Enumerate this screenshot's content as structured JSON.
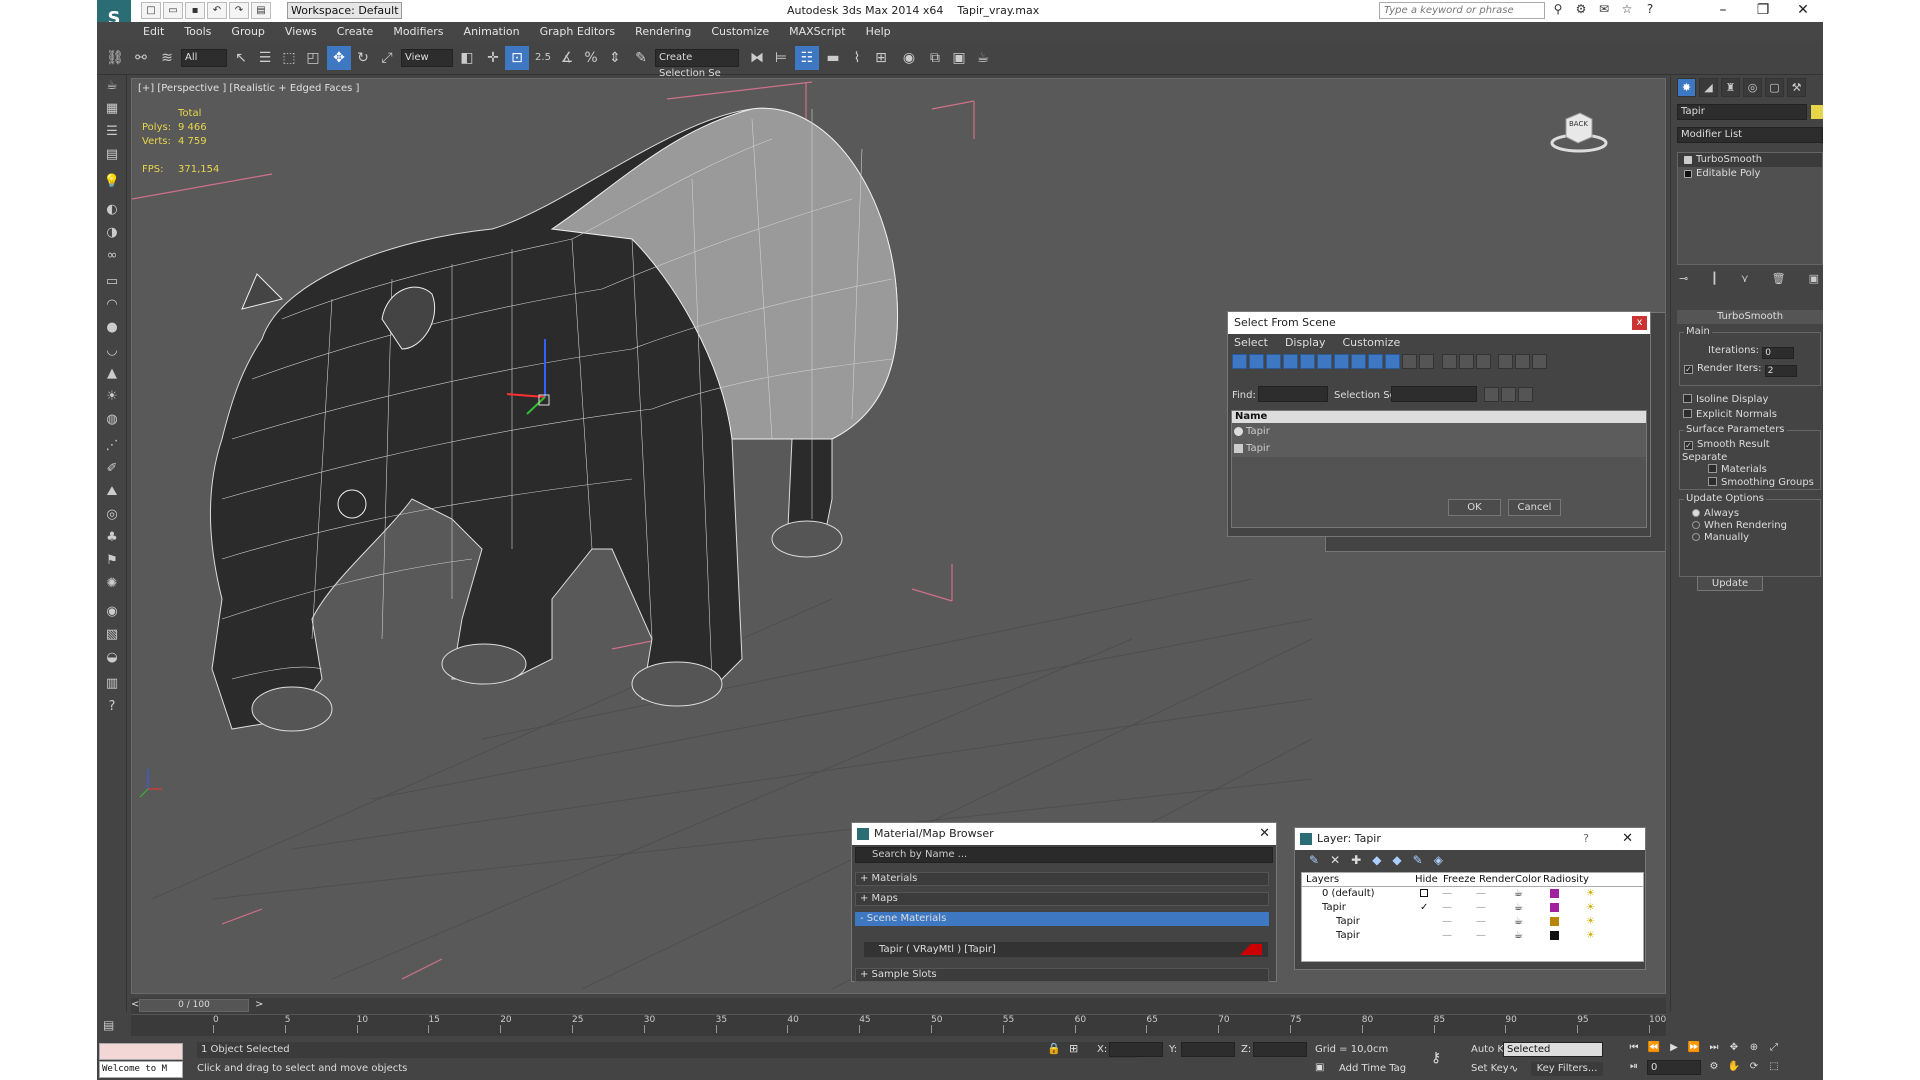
{
  "window": {
    "app_title": "Autodesk 3ds Max  2014 x64",
    "file": "Tapir_vray.max",
    "workspace": "Workspace: Default",
    "search_placeholder": "Type a keyword or phrase"
  },
  "menu": [
    "Edit",
    "Tools",
    "Group",
    "Views",
    "Create",
    "Modifiers",
    "Animation",
    "Graph Editors",
    "Rendering",
    "Customize",
    "MAXScript",
    "Help"
  ],
  "toolbar": {
    "filter": "All",
    "refcoord": "View",
    "snap_value": "2.5",
    "selset": "Create Selection Se"
  },
  "viewport": {
    "label": "[+] [Perspective ] [Realistic + Edged Faces ]",
    "stats": {
      "total": "Total",
      "polys_label": "Polys:",
      "polys": "9 466",
      "verts_label": "Verts:",
      "verts": "4 759",
      "fps_label": "FPS:",
      "fps": "371,154"
    },
    "viewcube": "BACK"
  },
  "command_panel": {
    "object_name": "Tapir",
    "object_color": "#e8d64a",
    "modifier_list": "Modifier List",
    "stack": [
      "TurboSmooth",
      "Editable Poly"
    ],
    "turbosmooth": {
      "title": "TurboSmooth",
      "main": "Main",
      "iterations_label": "Iterations:",
      "iterations": "0",
      "render_iters_label": "Render Iters:",
      "render_iters": "2",
      "isoline": "Isoline Display",
      "explicit_normals": "Explicit Normals",
      "surface": "Surface Parameters",
      "smooth_result": "Smooth Result",
      "separate": "Separate",
      "materials": "Materials",
      "smoothing_groups": "Smoothing Groups",
      "update_options": "Update Options",
      "always": "Always",
      "when_rendering": "When Rendering",
      "manually": "Manually",
      "update": "Update"
    }
  },
  "select_dialog": {
    "title": "Select From Scene",
    "menu": [
      "Select",
      "Display",
      "Customize"
    ],
    "find_label": "Find:",
    "selset_label": "Selection Set:",
    "col_name": "Name",
    "rows": [
      "Tapir",
      "Tapir"
    ],
    "ok": "OK",
    "cancel": "Cancel"
  },
  "material_browser": {
    "title": "Material/Map Browser",
    "search": "Search by Name ...",
    "materials": "+ Materials",
    "maps": "+ Maps",
    "scene_materials": "- Scene Materials",
    "material": "Tapir  ( VRayMtl )  [Tapir]",
    "sample_slots": "+ Sample Slots"
  },
  "layer_dialog": {
    "title": "Layer: Tapir",
    "help": "?",
    "cols": [
      "Layers",
      "Hide",
      "Freeze",
      "Render",
      "Color",
      "Radiosity"
    ],
    "rows": [
      {
        "name": "0 (default)",
        "color": "#a020a0"
      },
      {
        "name": "Tapir",
        "color": "#a020a0"
      },
      {
        "name": "Tapir",
        "color": "#b8860b"
      },
      {
        "name": "Tapir",
        "color": "#111111"
      }
    ]
  },
  "timeline": {
    "slider": "0 / 100",
    "ticks": [
      "0",
      "5",
      "10",
      "15",
      "20",
      "25",
      "30",
      "35",
      "40",
      "45",
      "50",
      "55",
      "60",
      "65",
      "70",
      "75",
      "80",
      "85",
      "90",
      "95",
      "100"
    ]
  },
  "status": {
    "maxscript": "Welcome to M",
    "selected": "1 Object Selected",
    "prompt": "Click and drag to select and move objects",
    "x": "X:",
    "y": "Y:",
    "z": "Z:",
    "grid": "Grid = 10,0cm",
    "add_time_tag": "Add Time Tag",
    "auto_key": "Auto Key",
    "set_key": "Set Key",
    "key_mode": "Selected",
    "key_filters": "Key Filters...",
    "frame": "0"
  }
}
